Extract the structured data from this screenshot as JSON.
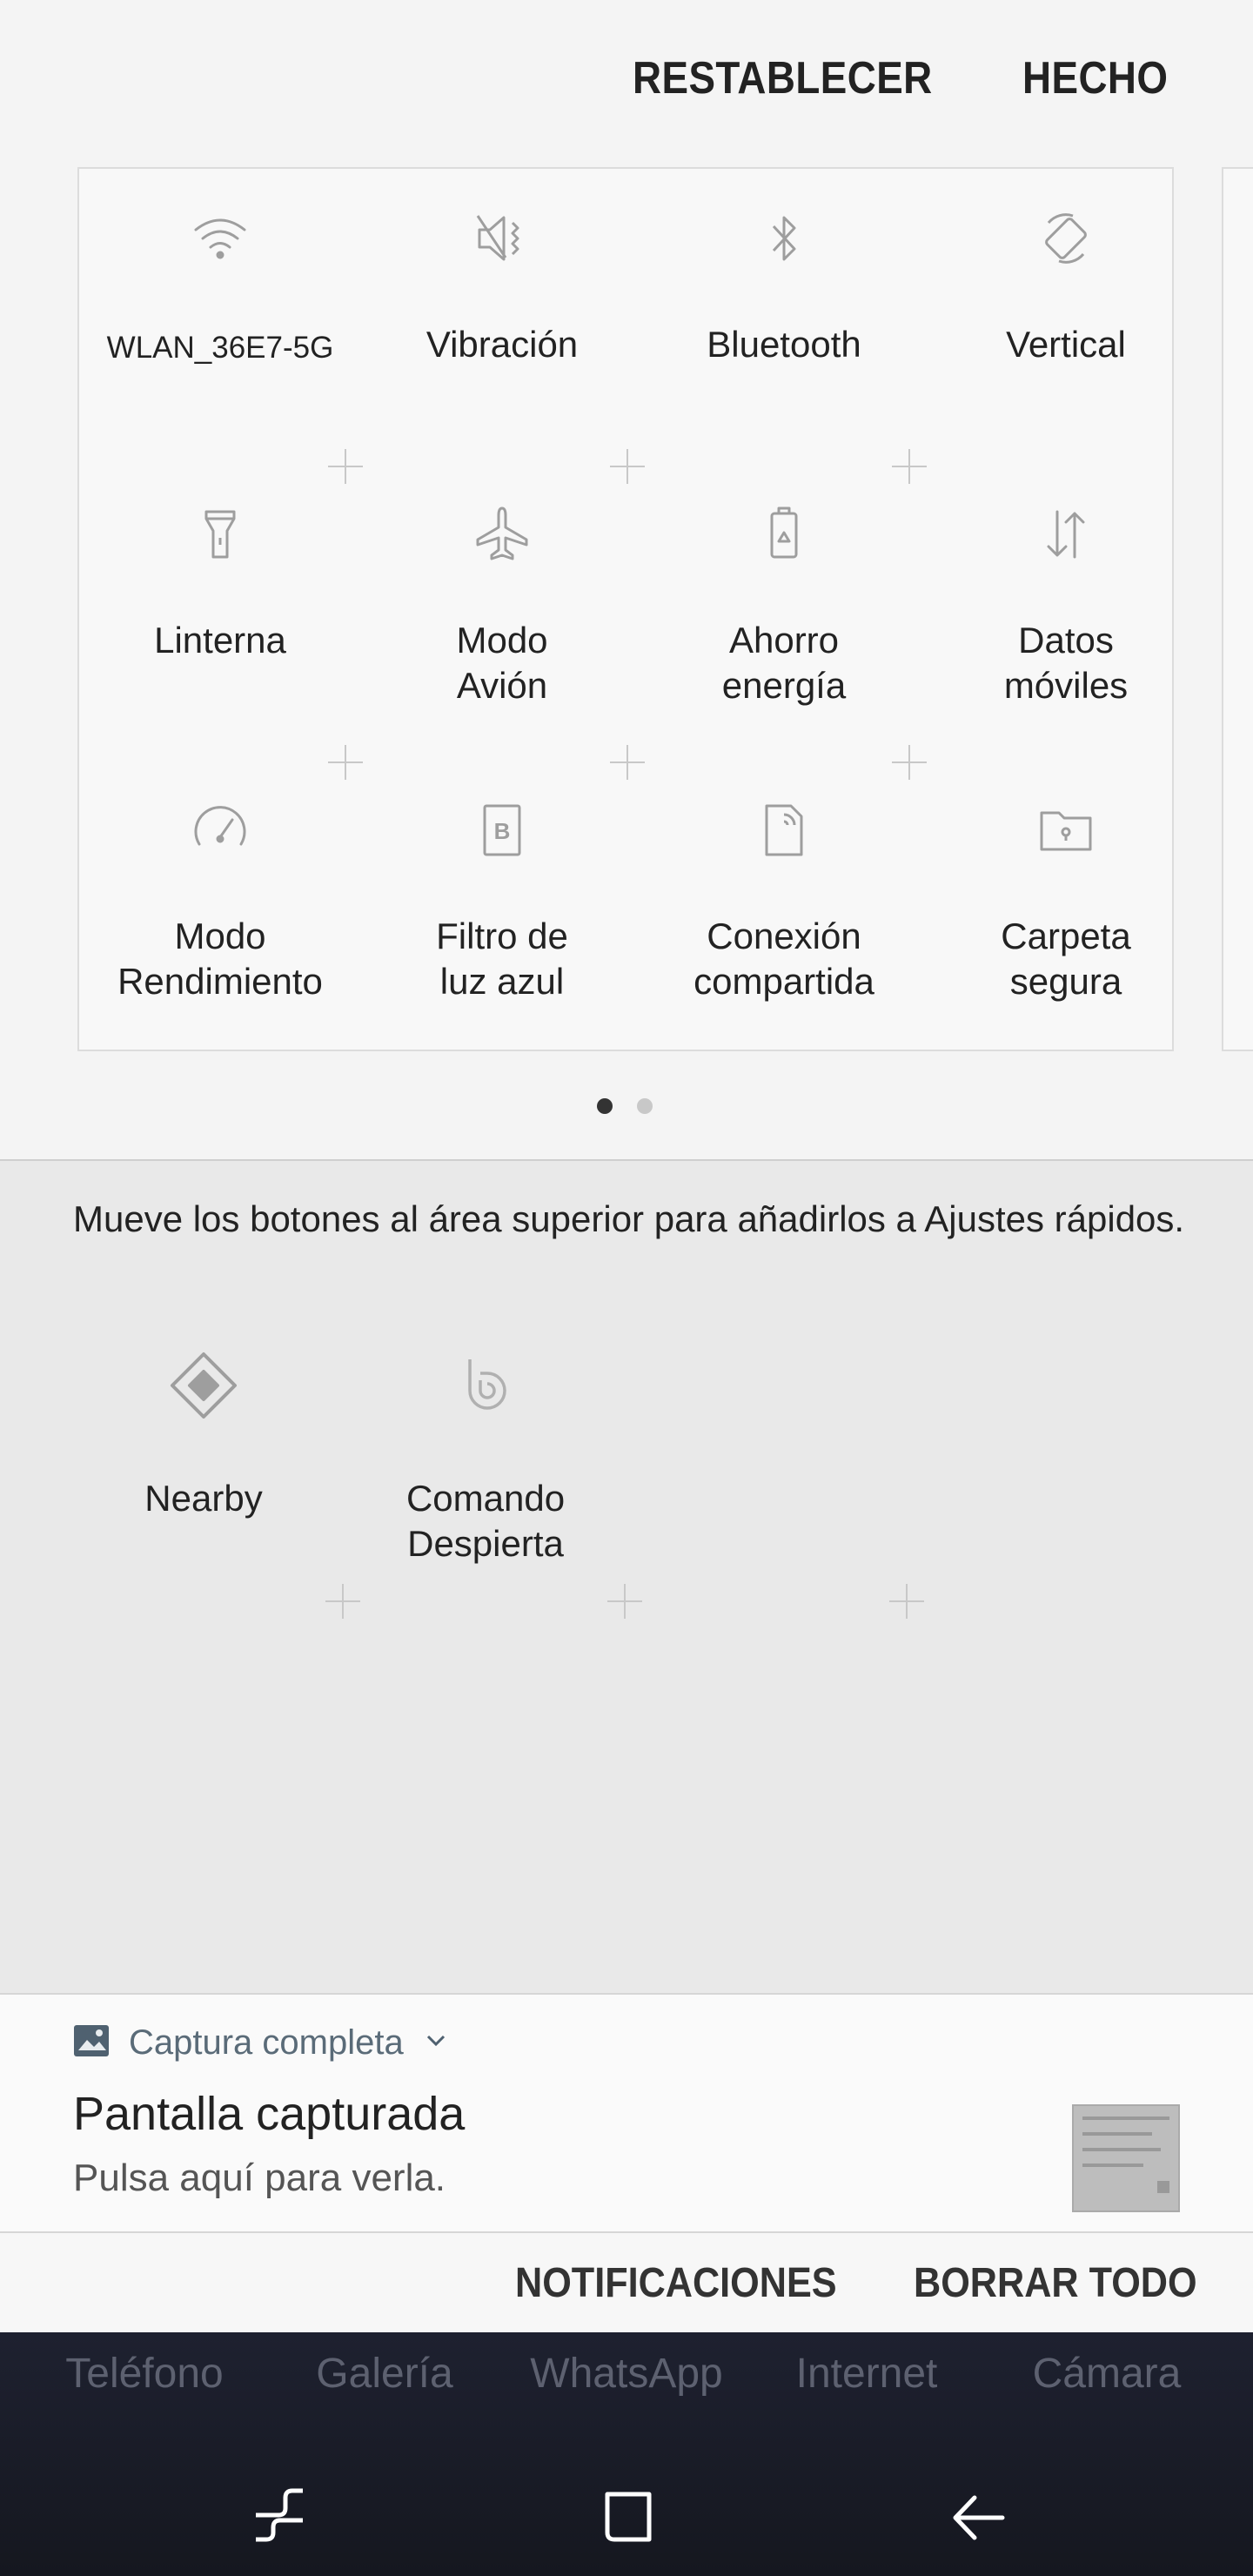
{
  "header": {
    "reset_label": "RESTABLECER",
    "done_label": "HECHO"
  },
  "tiles": [
    {
      "label": "WLAN_36E7-5G",
      "icon": "wifi-icon"
    },
    {
      "label": "Vibración",
      "icon": "vibrate-icon"
    },
    {
      "label": "Bluetooth",
      "icon": "bluetooth-icon"
    },
    {
      "label": "Vertical",
      "icon": "rotate-icon"
    },
    {
      "label": "Linterna",
      "icon": "flashlight-icon"
    },
    {
      "label": "Modo\nAvión",
      "icon": "airplane-icon"
    },
    {
      "label": "Ahorro\nenergía",
      "icon": "battery-saver-icon"
    },
    {
      "label": "Datos\nmóviles",
      "icon": "mobile-data-icon"
    },
    {
      "label": "Modo\nRendimiento",
      "icon": "performance-icon"
    },
    {
      "label": "Filtro de\nluz azul",
      "icon": "blue-light-filter-icon"
    },
    {
      "label": "Conexión\ncompartida",
      "icon": "hotspot-icon"
    },
    {
      "label": "Carpeta\nsegura",
      "icon": "secure-folder-icon"
    }
  ],
  "pagination": {
    "current": 1,
    "total": 2
  },
  "tray": {
    "hint": "Mueve los botones al área superior para añadirlos a Ajustes rápidos.",
    "tiles": [
      {
        "label": "Nearby",
        "icon": "nearby-icon"
      },
      {
        "label": "Comando\nDespierta",
        "icon": "bixby-icon"
      }
    ]
  },
  "notification": {
    "app_name": "Captura completa",
    "title": "Pantalla capturada",
    "text": "Pulsa aquí para verla."
  },
  "notification_actions": {
    "notifications_label": "NOTIFICACIONES",
    "clear_all_label": "BORRAR TODO"
  },
  "dock": {
    "apps": [
      "Teléfono",
      "Galería",
      "WhatsApp",
      "Internet",
      "Cámara"
    ]
  },
  "colors": {
    "icon_gray": "#9e9e9e",
    "dock_bg": "#1a1c26"
  }
}
